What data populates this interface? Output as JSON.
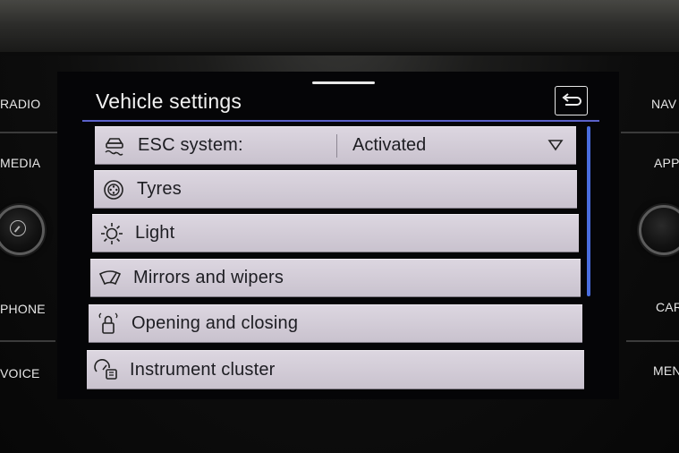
{
  "left_buttons": [
    "RADIO",
    "MEDIA",
    "PHONE",
    "VOICE"
  ],
  "right_buttons": [
    "NAV",
    "APP",
    "CAR",
    "MENU"
  ],
  "screen": {
    "title": "Vehicle settings",
    "items": [
      {
        "label": "ESC system:",
        "value": "Activated",
        "icon": "esc-car-skid-icon"
      },
      {
        "label": "Tyres",
        "icon": "tyre-icon"
      },
      {
        "label": "Light",
        "icon": "sun-light-icon"
      },
      {
        "label": "Mirrors and wipers",
        "icon": "wiper-icon"
      },
      {
        "label": "Opening and closing",
        "icon": "lock-icon"
      },
      {
        "label": "Instrument cluster",
        "icon": "instrument-cluster-icon"
      }
    ]
  },
  "colors": {
    "accent_line": "#5b62c9",
    "scrollbar": "#4a6ee0",
    "item_bg": "#d6d0da"
  }
}
